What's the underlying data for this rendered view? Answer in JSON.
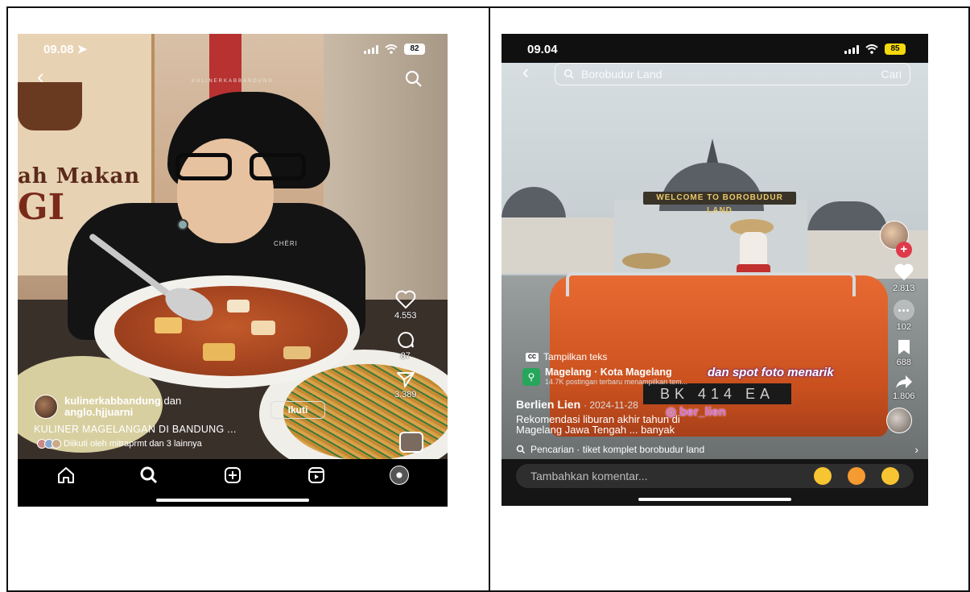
{
  "left_phone": {
    "status": {
      "time": "09.08",
      "battery": "82"
    },
    "watermark": "KULINERKABBANDUNG",
    "sign": {
      "line1": "ah Makan",
      "line2": "GI"
    },
    "shirt_brand": "CHÈRI",
    "actions": {
      "likes": "4.553",
      "comments": "87",
      "shares": "3.389"
    },
    "author": {
      "name": "kulinerkabbandung",
      "connector": "dan",
      "collab": "anglo.hjjuarni"
    },
    "follow_label": "Ikuti",
    "caption": "KULINER MAGELANGAN DI BANDUNG ...",
    "followed_by": "Diikuti oleh mitraprmt dan 3 lainnya",
    "nav": [
      "home-icon",
      "search-icon",
      "create-icon",
      "reels-icon",
      "profile-avatar"
    ]
  },
  "right_phone": {
    "status": {
      "time": "09.04",
      "battery": "85"
    },
    "search": {
      "query": "Borobudur Land",
      "action": "Cari"
    },
    "gate_banner": "WELCOME TO BOROBUDUR LAND",
    "plate": "BK 414 EA",
    "actions": {
      "likes": "2.813",
      "comments": "102",
      "saves": "688",
      "shares": "1.806"
    },
    "cc_label": "Tampilkan teks",
    "overlay_text": "dan spot foto menarik",
    "handle": "ber_lien",
    "location": {
      "title": "Magelang · Kota Magelang",
      "subtitle": "14.7K postingan terbaru menampilkan tem..."
    },
    "author": {
      "name": "Berlien Lien",
      "date": "· 2024-11-28"
    },
    "caption_line1": "Rekomendasi liburan akhir tahun di",
    "caption_line2": "Magelang Jawa Tengah ... banyak",
    "suggestion": "Pencarian · tiket komplet borobudur land",
    "comment_placeholder": "Tambahkan komentar..."
  },
  "colors": {
    "accent_red": "#e03a4a",
    "location_green": "#26a65b",
    "battery_yellow": "#f5d90a"
  }
}
